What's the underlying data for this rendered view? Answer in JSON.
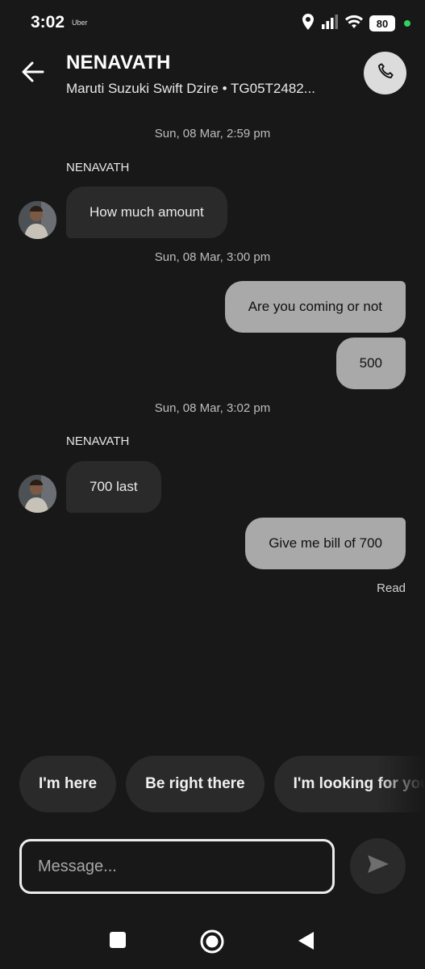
{
  "status_bar": {
    "time": "3:02",
    "app": "Uber",
    "battery": "80",
    "icons": [
      "location-icon",
      "signal-icon",
      "wifi-icon",
      "battery-icon"
    ]
  },
  "header": {
    "name": "NENAVATH",
    "subtitle": "Maruti Suzuki Swift Dzire • TG05T2482..."
  },
  "messages": {
    "ts1": "Sun, 08 Mar, 2:59 pm",
    "sender1": "NENAVATH",
    "msg1": "How much amount",
    "ts2": "Sun, 08 Mar, 3:00 pm",
    "msg2": "Are you coming or not",
    "msg3": "500",
    "ts3": "Sun, 08 Mar, 3:02 pm",
    "sender2": "NENAVATH",
    "msg4": "700 last",
    "msg5": "Give me bill of 700",
    "read": "Read"
  },
  "quick_replies": [
    "I'm here",
    "Be right there",
    "I'm looking for you"
  ],
  "input": {
    "placeholder": "Message..."
  },
  "colors": {
    "background": "#181818",
    "incoming_bubble": "#2a2a2a",
    "outgoing_bubble": "#a9a9a9"
  }
}
